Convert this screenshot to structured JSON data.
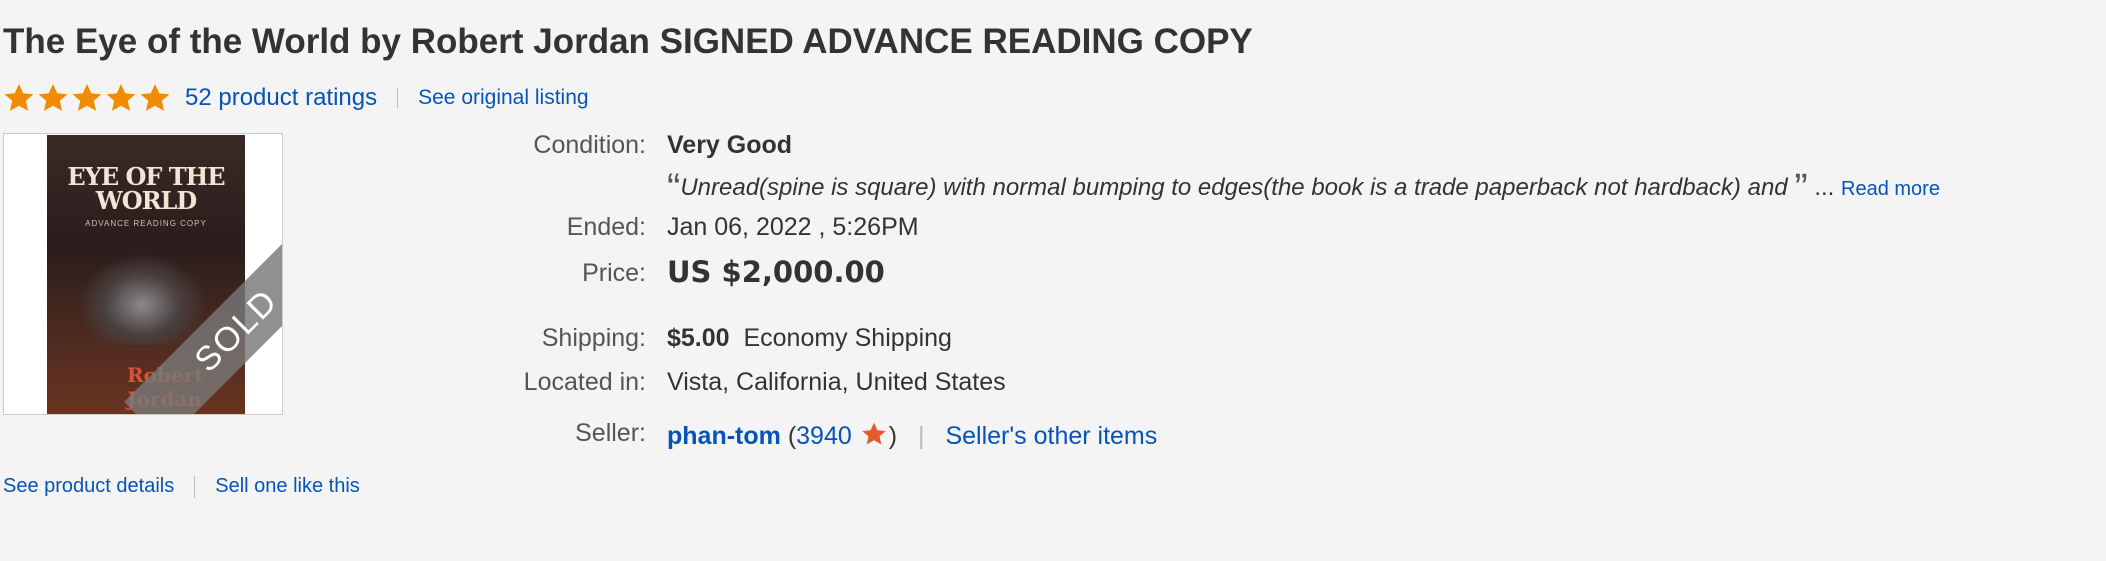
{
  "title": "The Eye of the World by Robert Jordan SIGNED ADVANCE READING COPY",
  "rating": {
    "stars": 5,
    "ratings_text": "52 product ratings",
    "original_listing": "See original listing",
    "star_color": "#f18c00"
  },
  "image": {
    "book_title": "EYE OF THE WORLD",
    "book_subtitle": "ADVANCE READING COPY",
    "book_author": "Robert Jordan",
    "sold_badge": "SOLD"
  },
  "details": {
    "condition_label": "Condition:",
    "condition_value": "Very Good",
    "condition_desc": "Unread(spine is square) with normal bumping to edges(the book is a trade paperback not hardback) and",
    "read_more": "Read more",
    "ellipsis": "...",
    "ended_label": "Ended:",
    "ended_value": "Jan 06, 2022 , 5:26PM",
    "price_label": "Price:",
    "price_value": "US $2,000.00",
    "shipping_label": "Shipping:",
    "shipping_cost": "$5.00",
    "shipping_method": "Economy Shipping",
    "located_label": "Located in:",
    "located_value": "Vista, California, United States",
    "seller_label": "Seller:",
    "seller_name": "phan-tom",
    "seller_score": "3940",
    "seller_other": "Seller's other items"
  },
  "bottom": {
    "product_details": "See product details",
    "sell_one": "Sell one like this"
  },
  "colors": {
    "link": "#0654ba",
    "sold_band": "#787878",
    "star_badge": "#e25b2d"
  }
}
